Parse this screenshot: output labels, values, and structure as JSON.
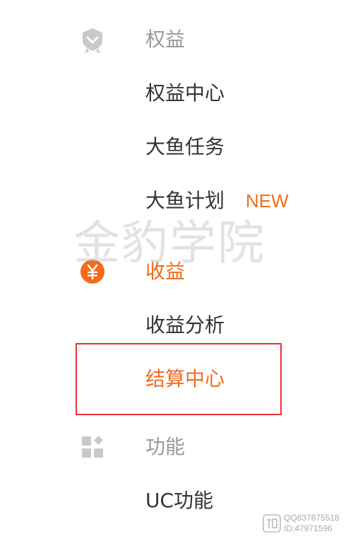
{
  "menu": {
    "quanyi": {
      "section_label": "权益",
      "icon": "badge-icon",
      "items": [
        {
          "label": "权益中心"
        },
        {
          "label": "大鱼任务"
        },
        {
          "label": "大鱼计划",
          "badge": "NEW"
        }
      ]
    },
    "shouyi": {
      "section_label": "收益",
      "icon": "yuan-icon",
      "active": true,
      "items": [
        {
          "label": "收益分析"
        },
        {
          "label": "结算中心",
          "active": true,
          "highlighted": true
        }
      ]
    },
    "gongneng": {
      "section_label": "功能",
      "icon": "grid-icon",
      "items": [
        {
          "label": "UC功能"
        }
      ]
    }
  },
  "watermark": {
    "center_text": "金豹学院",
    "corner_line1": "QQ837675518",
    "corner_line2": "ID:47971596"
  },
  "colors": {
    "accent": "#f36b1c",
    "text": "#333333",
    "section_gray": "#999999",
    "highlight_border": "#e8303a"
  }
}
